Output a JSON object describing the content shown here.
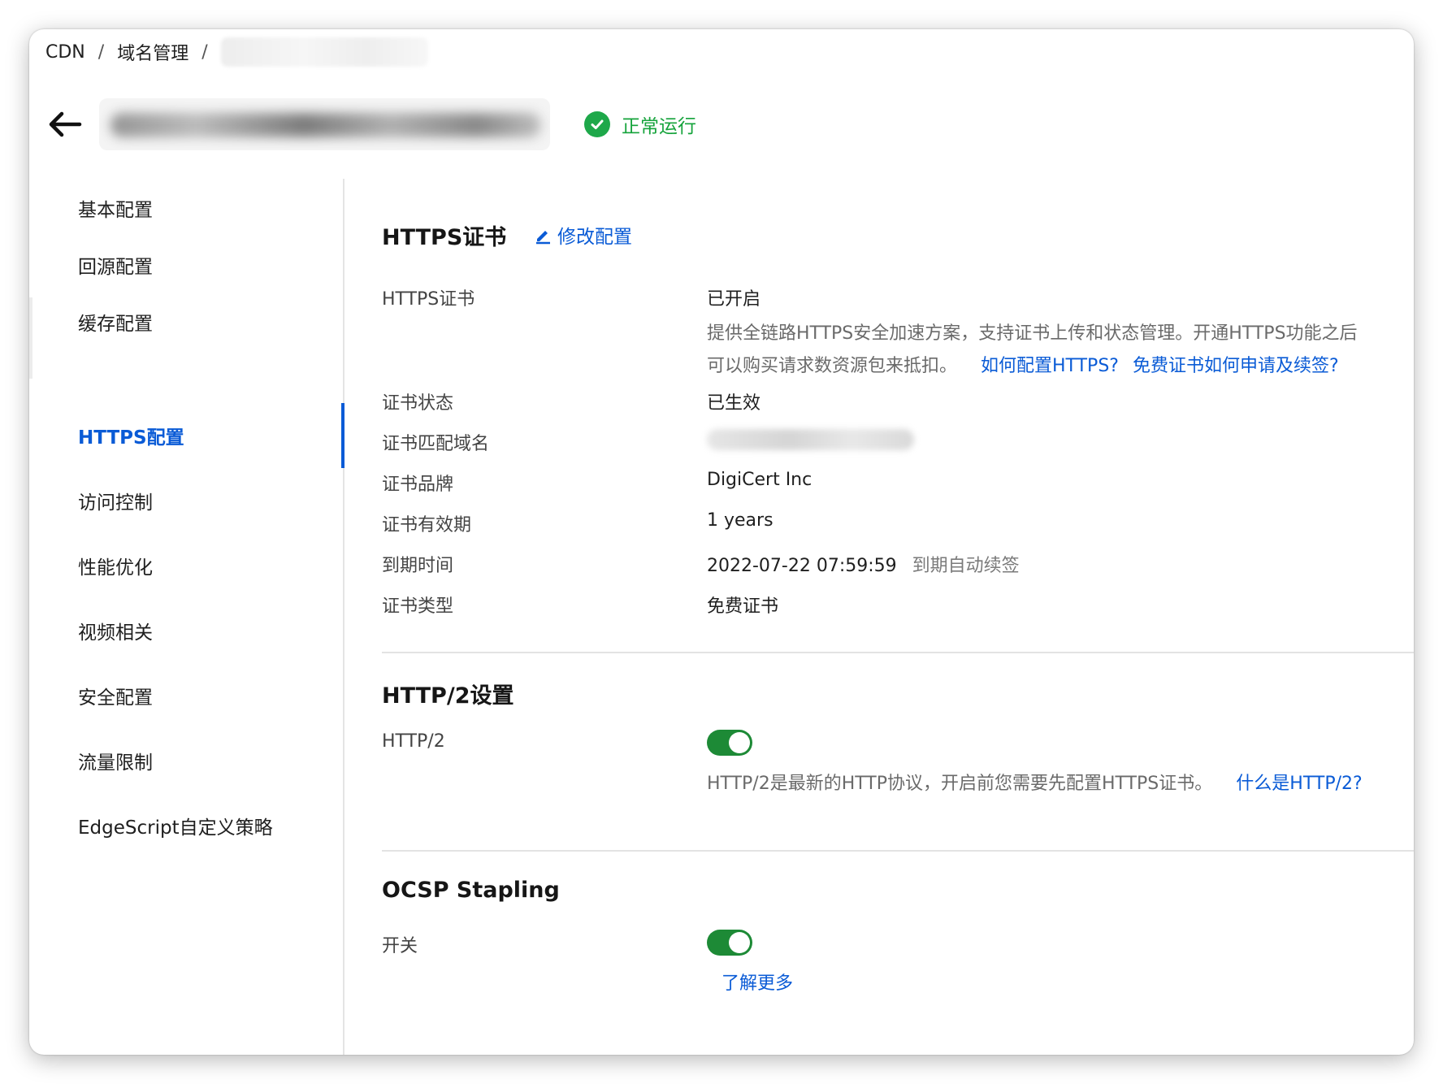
{
  "breadcrumb": {
    "items": [
      "CDN",
      "域名管理"
    ],
    "separator": "/"
  },
  "header": {
    "status_label": "正常运行",
    "status_color": "#15a33b"
  },
  "sidebar": {
    "items": [
      {
        "label": "基本配置"
      },
      {
        "label": "回源配置"
      },
      {
        "label": "缓存配置"
      },
      {
        "label": "HTTPS配置",
        "active": true
      },
      {
        "label": "访问控制"
      },
      {
        "label": "性能优化"
      },
      {
        "label": "视频相关"
      },
      {
        "label": "安全配置"
      },
      {
        "label": "流量限制"
      },
      {
        "label": "EdgeScript自定义策略"
      }
    ],
    "accent_color": "#0a5bd6"
  },
  "https_cert": {
    "title": "HTTPS证书",
    "edit_label": "修改配置",
    "rows": {
      "cert_label": "HTTPS证书",
      "cert_value": "已开启",
      "cert_desc_line1": "提供全链路HTTPS安全加速方案，支持证书上传和状态管理。开通HTTPS功能之后",
      "cert_desc_line2": "可以购买请求数资源包来抵扣。",
      "cert_link1": "如何配置HTTPS?",
      "cert_link2": "免费证书如何申请及续签?",
      "status_label": "证书状态",
      "status_value": "已生效",
      "domain_label": "证书匹配域名",
      "brand_label": "证书品牌",
      "brand_value": "DigiCert Inc",
      "validity_label": "证书有效期",
      "validity_value": "1 years",
      "expiry_label": "到期时间",
      "expiry_value": "2022-07-22 07:59:59",
      "expiry_note": "到期自动续签",
      "type_label": "证书类型",
      "type_value": "免费证书"
    }
  },
  "http2": {
    "title": "HTTP/2设置",
    "label": "HTTP/2",
    "enabled": true,
    "desc": "HTTP/2是最新的HTTP协议，开启前您需要先配置HTTPS证书。",
    "link": "什么是HTTP/2?"
  },
  "ocsp": {
    "title": "OCSP Stapling",
    "label": "开关",
    "enabled": true,
    "link": "了解更多"
  },
  "colors": {
    "toggle_on": "#1d8a36",
    "link": "#0a5bd6"
  }
}
